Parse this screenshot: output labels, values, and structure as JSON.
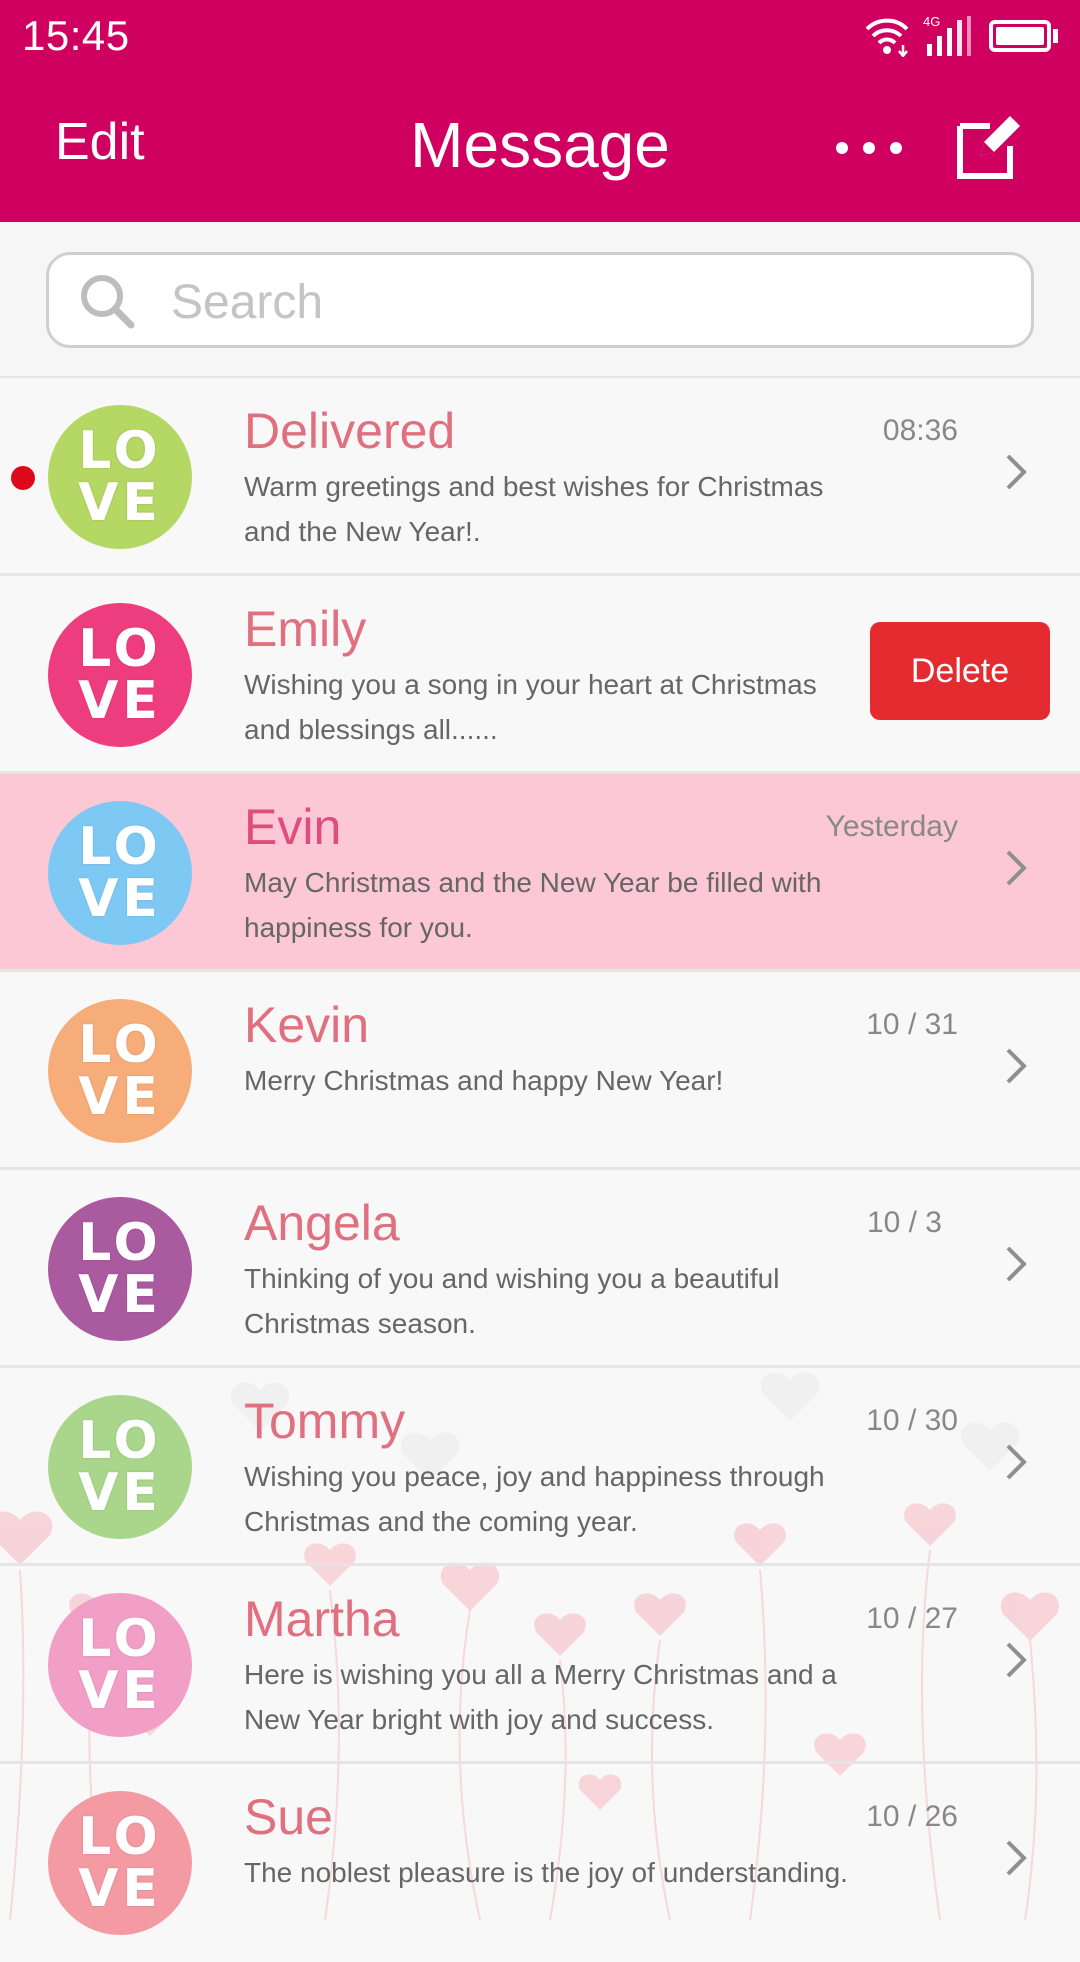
{
  "status": {
    "time": "15:45",
    "network": "4G"
  },
  "header": {
    "edit_label": "Edit",
    "title": "Message"
  },
  "search": {
    "placeholder": "Search"
  },
  "colors": {
    "accent": "#cf005f",
    "selected_row": "#fcc8d6",
    "delete": "#e42b30",
    "name_text": "#e07080"
  },
  "conversations": [
    {
      "name": "Delivered",
      "time": "08:36",
      "preview": "Warm greetings and best wishes for Christmas and the New Year!.",
      "avatar_text_1": "LO",
      "avatar_text_2": "VE",
      "avatar_color": "#b5d764",
      "unread": true
    },
    {
      "name": "Emily",
      "time": "",
      "preview": "Wishing you a song in your heart at Christmas and blessings all......",
      "avatar_text_1": "LO",
      "avatar_text_2": "VE",
      "avatar_color": "#ee3d7e",
      "delete_label": "Delete"
    },
    {
      "name": "Evin",
      "time": "Yesterday",
      "preview": "May Christmas and the New Year be filled with happiness for you.",
      "avatar_text_1": "LO",
      "avatar_text_2": "VE",
      "avatar_color": "#7ec9f3",
      "selected": true
    },
    {
      "name": "Kevin",
      "time": "10 / 31",
      "preview": "Merry Christmas and happy New Year!",
      "avatar_text_1": "LO",
      "avatar_text_2": "VE",
      "avatar_color": "#f6ad79"
    },
    {
      "name": "Angela",
      "time": "10 / 3",
      "preview": "Thinking of you and wishing you a beautiful Christmas season.",
      "avatar_text_1": "LO",
      "avatar_text_2": "VE",
      "avatar_color": "#aa5a9f"
    },
    {
      "name": "Tommy",
      "time": "10 / 30",
      "preview": "Wishing you peace, joy and happiness through Christmas and the coming year.",
      "avatar_text_1": "LO",
      "avatar_text_2": "VE",
      "avatar_color": "#a9d68b"
    },
    {
      "name": "Martha",
      "time": "10 / 27",
      "preview": "Here is wishing you all a Merry Christmas and a New Year bright with joy and success.",
      "avatar_text_1": "LO",
      "avatar_text_2": "VE",
      "avatar_color": "#f19fc7"
    },
    {
      "name": "Sue",
      "time": "10 / 26",
      "preview": "The noblest pleasure is the joy of understanding.",
      "avatar_text_1": "LO",
      "avatar_text_2": "VE",
      "avatar_color": "#f39aa2"
    }
  ]
}
